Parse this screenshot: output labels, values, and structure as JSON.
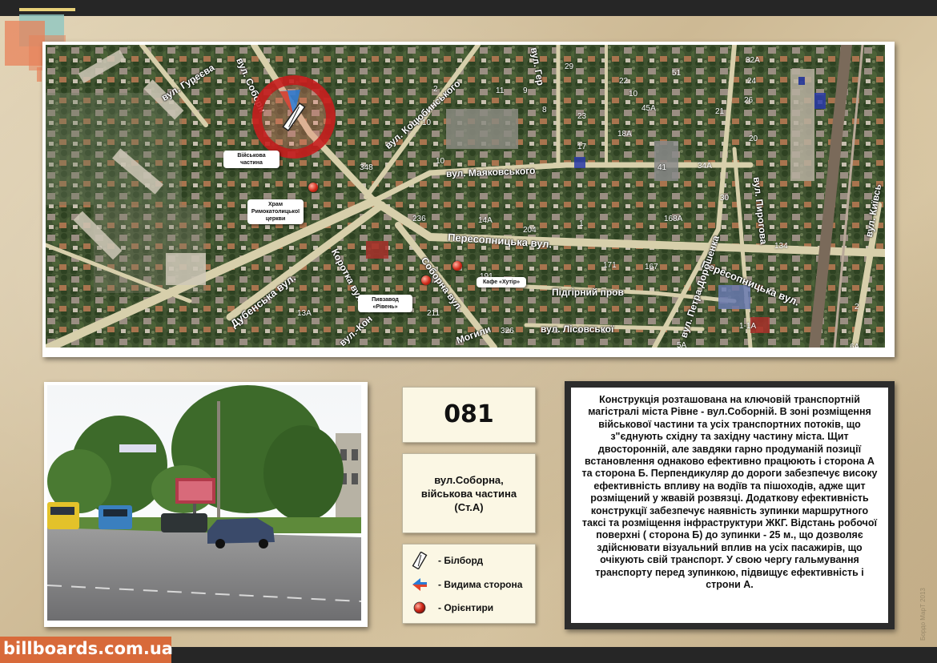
{
  "site": {
    "badge": "billboards.com.ua",
    "copyright": "Бордо МарТ 2013"
  },
  "map": {
    "streets": [
      {
        "id": "sobornyi-top",
        "text": "вул. Соборн"
      },
      {
        "id": "hurieva",
        "text": "вул. Гуреєва"
      },
      {
        "id": "kotsiubynskoho",
        "text": "вул. Коцюбинського"
      },
      {
        "id": "mayakovskoho",
        "text": "вул. Маяковського"
      },
      {
        "id": "peresopnytska",
        "text": "Пересопницька вул."
      },
      {
        "id": "peresopnytska2",
        "text": "Пересопницька вул."
      },
      {
        "id": "dubenska",
        "text": "Дубенська вул."
      },
      {
        "id": "korotka",
        "text": "Коротка вул."
      },
      {
        "id": "soborna",
        "text": "Соборна вул."
      },
      {
        "id": "pidhirnyi",
        "text": "Підгірний пров"
      },
      {
        "id": "lisovskoi",
        "text": "вул. Лісовської"
      },
      {
        "id": "doroshenka",
        "text": "вул. Петра Дорошенка"
      },
      {
        "id": "pyrohova",
        "text": "вул. Пирогова"
      },
      {
        "id": "kyivska",
        "text": "вул. Київсь"
      },
      {
        "id": "mohyly",
        "text": "Могили"
      },
      {
        "id": "kon",
        "text": "вул.-Кон"
      },
      {
        "id": "her",
        "text": "вул. Гер"
      }
    ],
    "house_numbers": [
      "10",
      "2",
      "11",
      "9",
      "8",
      "29",
      "22",
      "51",
      "32А",
      "24",
      "10",
      "23",
      "45А",
      "21",
      "26",
      "18А",
      "17",
      "20",
      "348",
      "10",
      "41",
      "34А",
      "30",
      "236",
      "14А",
      "204",
      "1",
      "168А",
      "134",
      "171",
      "167",
      "191",
      "13А",
      "211",
      "326",
      "1-1А",
      "5А",
      "6А",
      "2"
    ],
    "callouts": {
      "military": "Військова частина",
      "church": "Храм Римокатолицької церкви",
      "brewery": "Пивзавод «Рівень»",
      "cafe": "Кафе «Хутір»"
    }
  },
  "code": "081",
  "address": "вул.Соборна, військова частина (Ст.А)",
  "legend": {
    "billboard": "- Білборд",
    "visible_side": "- Видима сторона",
    "landmarks": "- Орієнтири"
  },
  "description": "Конструкція розташована на ключовій транспортній магістралі міста Рівне - вул.Соборній. В зоні розміщення військової частини та усіх транспортних потоків, що з\"єднують східну та західну частину міста. Щит двосторонній, але завдяки гарно продуманій позиції встановлення однаково ефективно працюють і сторона А та сторона Б. Перпендикуляр до дороги забезпечує високу ефективність впливу на водіїв та пішоходів, адже щит розміщений у жвавій розвязці. Додаткову ефективність конструкції забезпечує наявність зупинки маршрутного таксі та розміщення інфраструктури ЖКГ. Відстань робочої поверхні ( сторона Б) до зупинки - 25 м., що дозволяє здійснювати візуальний вплив на усіх пасажирів, що очікують свій транспорт. У свою чергу гальмування транспорту перед зупинкою, підвищує ефективність і строни А.",
  "colors": {
    "badge": "#d86a3a",
    "pin": "#d12a1a",
    "marker_ring": "#c81e1e"
  }
}
